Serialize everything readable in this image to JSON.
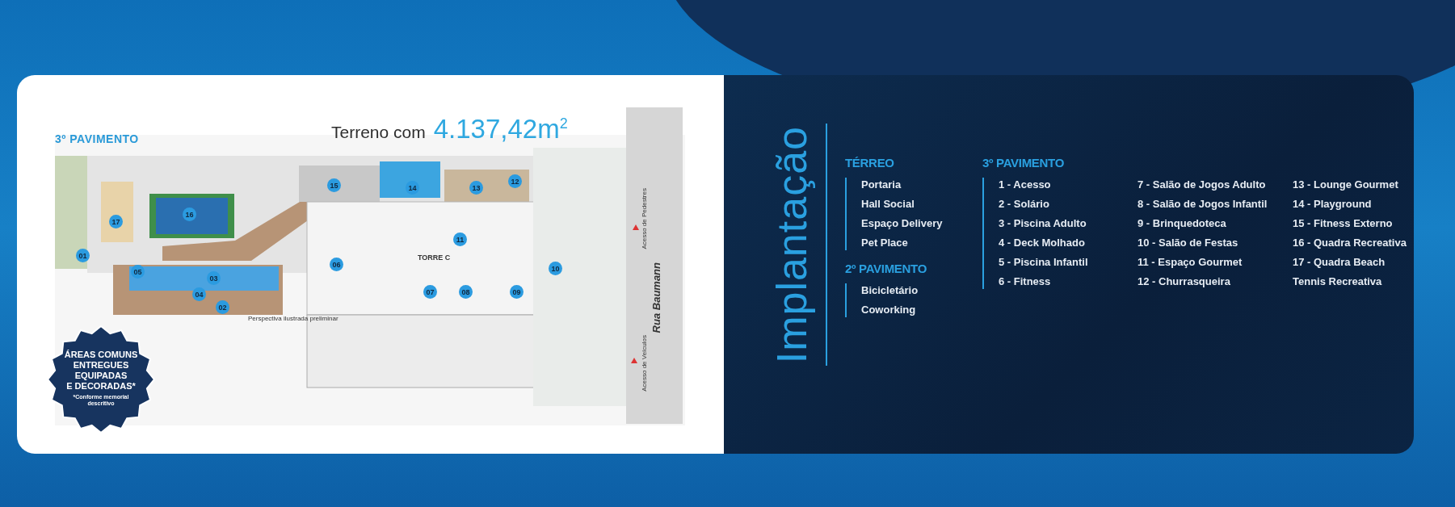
{
  "plan": {
    "area_label": "Terreno com",
    "area_value": "4.137,42m$^{2}$",
    "floor_label": "3º PAVIMENTO",
    "tower_label": "TORRE C",
    "caption": "Perspectiva ilustrada preliminar",
    "street": "Rua Baumann",
    "pedestrian_access": "Acesso de Pedestres",
    "vehicle_access": "Acesso de Veículos",
    "markers": [
      "15",
      "14",
      "13",
      "12",
      "17",
      "16",
      "11",
      "01",
      "05",
      "03",
      "06",
      "10",
      "04",
      "07",
      "08",
      "09",
      "02"
    ]
  },
  "badge": {
    "title_lines": [
      "ÁREAS COMUNS",
      "ENTREGUES",
      "EQUIPADAS",
      "E DECORADAS*"
    ],
    "note": "*Conforme memorial descritivo"
  },
  "legend": {
    "title": "Implantação",
    "sections": [
      {
        "title": "TÉRREO",
        "columns": [
          [
            "Portaria",
            "Hall Social",
            "Espaço Delivery",
            "Pet Place"
          ]
        ]
      },
      {
        "title": "2º PAVIMENTO",
        "columns": [
          [
            "Bicicletário",
            "Coworking"
          ]
        ]
      },
      {
        "title": "3º PAVIMENTO",
        "columns": [
          [
            "1 - Acesso",
            "2 - Solário",
            "3 - Piscina Adulto",
            "4 - Deck Molhado",
            "5 - Piscina Infantil",
            "6 - Fitness"
          ],
          [
            "7 - Salão de Jogos Adulto",
            "8 - Salão de Jogos Infantil",
            "9 - Brinquedoteca",
            "10 - Salão de Festas",
            "11 - Espaço Gourmet",
            "12 - Churrasqueira"
          ],
          [
            "13 - Lounge Gourmet",
            "14 - Playground",
            "15 - Fitness Externo",
            "16 - Quadra Recreativa",
            "17 - Quadra Beach",
            "Tennis Recreativa"
          ]
        ]
      }
    ]
  }
}
